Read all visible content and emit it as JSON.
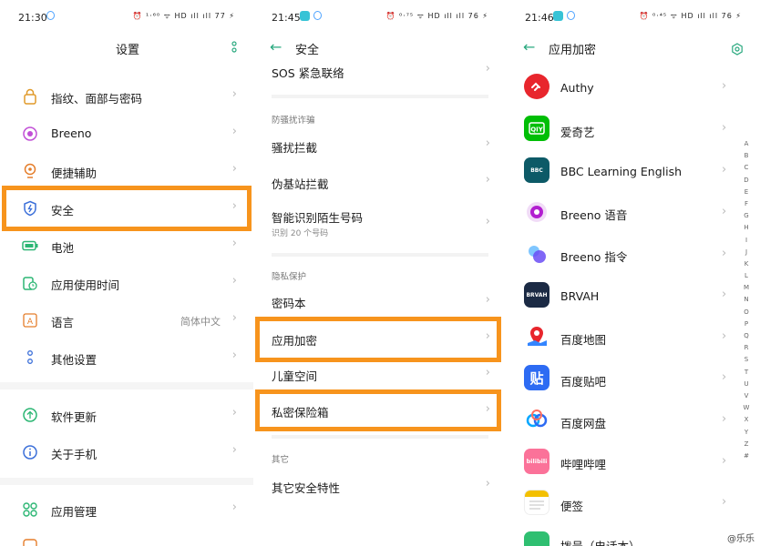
{
  "screen1": {
    "status": {
      "time": "21:30",
      "icons": "⏰ ¹·⁶⁰ ᯤ HD ıll ıll 77 ⚡"
    },
    "title": "设置",
    "items": [
      {
        "label": "指纹、面部与密码",
        "icon": "lock-icon"
      },
      {
        "label": "Breeno",
        "icon": "breeno-icon"
      },
      {
        "label": "便捷辅助",
        "icon": "assist-icon"
      },
      {
        "label": "安全",
        "icon": "shield-icon"
      },
      {
        "label": "电池",
        "icon": "battery-icon"
      },
      {
        "label": "应用使用时间",
        "icon": "screen-time-icon"
      },
      {
        "label": "语言",
        "value": "简体中文",
        "icon": "language-icon"
      },
      {
        "label": "其他设置",
        "icon": "other-settings-icon"
      },
      {
        "label": "软件更新",
        "icon": "update-icon"
      },
      {
        "label": "关于手机",
        "icon": "info-icon"
      },
      {
        "label": "应用管理",
        "icon": "app-manage-icon"
      },
      {
        "label": "...",
        "icon": "more-icon"
      }
    ]
  },
  "screen2": {
    "status": {
      "time": "21:45",
      "icons": "⏰ ⁰·⁷⁵ ᯤ HD ıll ıll 76 ⚡"
    },
    "title": "安全",
    "top_item": "SOS 紧急联络",
    "section_fraud": "防骚扰诈骗",
    "harass": "骚扰拦截",
    "fake_station": "伪基站拦截",
    "smart_id": "智能识别陌生号码",
    "smart_id_sub": "识别 20 个号码",
    "section_privacy": "隐私保护",
    "password_book": "密码本",
    "app_lock": "应用加密",
    "kid_space": "儿童空间",
    "private_safe": "私密保险箱",
    "section_other": "其它",
    "other_security": "其它安全特性"
  },
  "screen3": {
    "status": {
      "time": "21:46",
      "icons": "⏰ ⁰·⁴⁵ ᯤ HD ıll ıll 76 ⚡"
    },
    "title": "应用加密",
    "apps": [
      {
        "name": "Authy",
        "color": "#e8262d"
      },
      {
        "name": "爱奇艺",
        "color": "#00be06"
      },
      {
        "name": "BBC Learning English",
        "color": "#0d5a67"
      },
      {
        "name": "Breeno 语音",
        "color": "#8a2be2"
      },
      {
        "name": "Breeno 指令",
        "color": "#5b6cf0"
      },
      {
        "name": "BRVAH",
        "color": "#1b2a44"
      },
      {
        "name": "百度地图",
        "color": "#3385ff"
      },
      {
        "name": "百度贴吧",
        "color": "#2d6bf3"
      },
      {
        "name": "百度网盘",
        "color": "#06a7ff"
      },
      {
        "name": "哔哩哔哩",
        "color": "#fb7299"
      },
      {
        "name": "便签",
        "color": "#f3c000"
      },
      {
        "name": "拨号（电话本）",
        "color": "#2fbf71"
      }
    ],
    "index_letters": [
      "A",
      "B",
      "C",
      "D",
      "E",
      "F",
      "G",
      "H",
      "I",
      "J",
      "K",
      "L",
      "M",
      "N",
      "O",
      "P",
      "Q",
      "R",
      "S",
      "T",
      "U",
      "V",
      "W",
      "X",
      "Y",
      "Z",
      "#"
    ],
    "watermark": "@乐乐"
  },
  "colors": {
    "accent": "#2aa97f",
    "highlight": "#f7941d"
  }
}
